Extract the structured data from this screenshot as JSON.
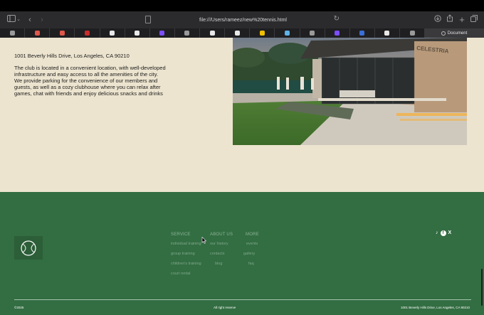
{
  "browser": {
    "url": "file:///Users/rameez/new%20tennis.html",
    "active_tab": "Document",
    "tab_favicon_colors": [
      "#9a9a9a",
      "#e0574b",
      "#e0574b",
      "#cc2b2b",
      "#e8e8e8",
      "#e8e8e8",
      "#7c4dff",
      "#9a9a9a",
      "#e8e8e8",
      "#e8e8e8",
      "#f0c000",
      "#5db3e8",
      "#9a9a9a",
      "#7c4dff",
      "#3a6fd8",
      "#e8e8e8",
      "#9a9a9a"
    ]
  },
  "about": {
    "address": "1001 Beverly Hills Drive, Los Angeles, CA 90210",
    "description": "The club is located in a convenient location, with well-developed infrastructure and easy access to all the amenities of the city. We provide parking for the convenience of our members and guests, as well as a cozy clubhouse where you can relax after games, chat with friends and enjoy delicious snacks and drinks",
    "sign_text": "CELESTRIA"
  },
  "footer": {
    "columns": [
      {
        "heading": "SERVICE",
        "items": [
          "individual training",
          "group training",
          "children's training",
          "court rental"
        ]
      },
      {
        "heading": "ABOUT US",
        "items": [
          "our history",
          "contacts",
          "blog"
        ]
      },
      {
        "heading": "MORE",
        "items": [
          "events",
          "gallery",
          "faq"
        ]
      }
    ],
    "social": [
      "♪",
      "f",
      "X"
    ],
    "copyright": "©2025",
    "rights": "All right reserve",
    "address": "1001 Beverly Hills Drive, Los Angeles, CA 90210"
  },
  "colors": {
    "about_bg": "#ece4cf",
    "footer_bg": "#336d42",
    "text_dark": "#1c1c1c"
  }
}
